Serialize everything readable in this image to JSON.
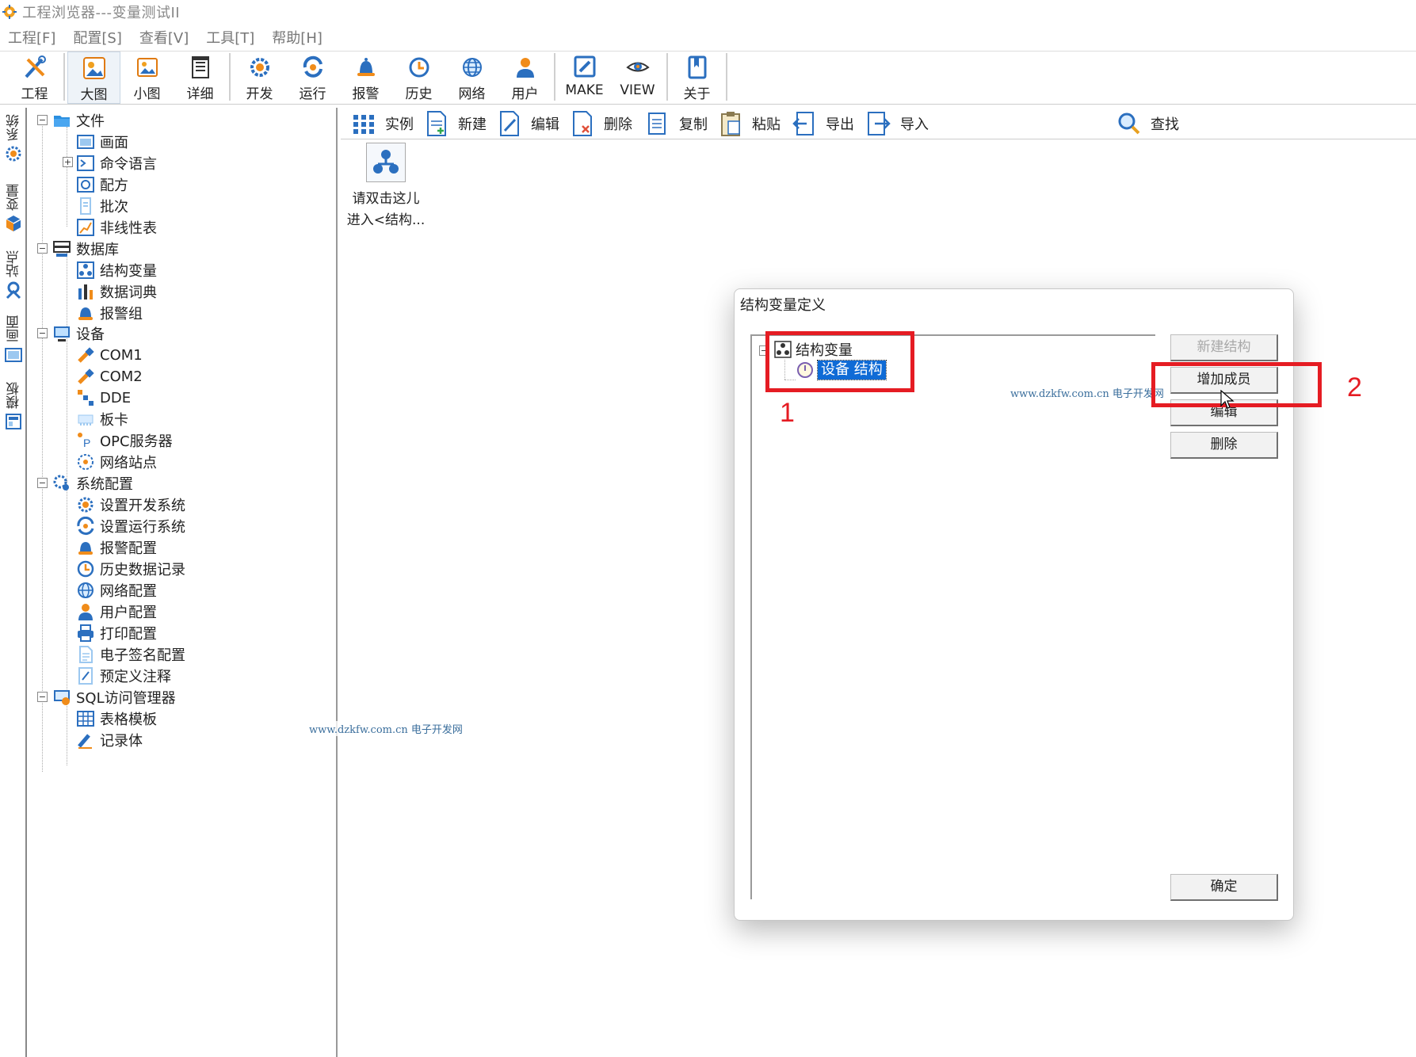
{
  "window": {
    "title": "工程浏览器---变量测试II"
  },
  "menu": [
    "工程[F]",
    "配置[S]",
    "查看[V]",
    "工具[T]",
    "帮助[H]"
  ],
  "toolbar": {
    "project": "工程",
    "large_icons": "大图",
    "small_icons": "小图",
    "details": "详细",
    "develop": "开发",
    "run": "运行",
    "alarm": "报警",
    "history": "历史",
    "network": "网络",
    "user": "用户",
    "make": "MAKE",
    "view": "VIEW",
    "about": "关于"
  },
  "side_tabs": [
    "系统",
    "变量",
    "站点",
    "画面",
    "模板"
  ],
  "tree": {
    "file": "文件",
    "screen": "画面",
    "command_lang": "命令语言",
    "recipe": "配方",
    "batch": "批次",
    "nonlinear": "非线性表",
    "database": "数据库",
    "struct_var": "结构变量",
    "data_dict": "数据词典",
    "alarm_group": "报警组",
    "device": "设备",
    "com1": "COM1",
    "com2": "COM2",
    "dde": "DDE",
    "board": "板卡",
    "opc": "OPC服务器",
    "net_station": "网络站点",
    "sys_config": "系统配置",
    "set_dev": "设置开发系统",
    "set_run": "设置运行系统",
    "alarm_cfg": "报警配置",
    "hist_rec": "历史数据记录",
    "net_cfg": "网络配置",
    "user_cfg": "用户配置",
    "print_cfg": "打印配置",
    "esign_cfg": "电子签名配置",
    "predef_note": "预定义注释",
    "sql_mgr": "SQL访问管理器",
    "table_tpl": "表格模板",
    "record": "记录体"
  },
  "subtoolbar": {
    "instance": "实例",
    "new": "新建",
    "edit": "编辑",
    "delete": "删除",
    "copy": "复制",
    "paste": "粘贴",
    "export": "导出",
    "import": "导入",
    "find": "查找"
  },
  "content": {
    "instance_line1": "请双击这儿",
    "instance_line2": "进入<结构..."
  },
  "watermark": {
    "url": "www.dzkfw.com.cn",
    "site": "电子开发网"
  },
  "dialog": {
    "title": "结构变量定义",
    "root": "结构变量",
    "child": "设备 结构",
    "buttons": {
      "new_struct": "新建结构",
      "add_member": "增加成员",
      "edit": "编辑",
      "delete": "删除",
      "ok": "确定"
    }
  },
  "annotations": {
    "box1": "1",
    "box2": "2"
  },
  "colors": {
    "annotation": "#e51c23",
    "selection": "#0f6bd6",
    "icon_blue": "#1c74c9",
    "icon_orange": "#f08c1a"
  }
}
